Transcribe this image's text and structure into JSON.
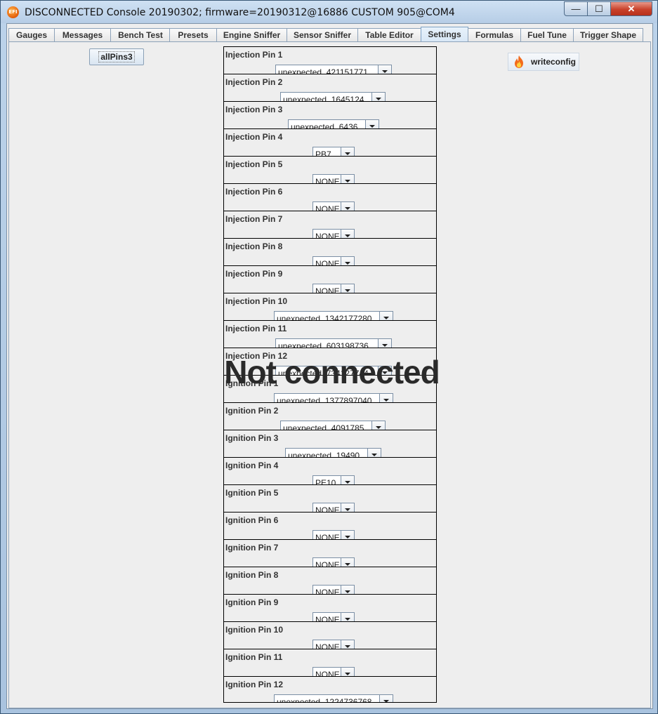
{
  "window": {
    "title": "DISCONNECTED Console 20190302; firmware=20190312@16886 CUSTOM 905@COM4",
    "icon_label": "EFI",
    "minimize_glyph": "—",
    "maximize_glyph": "☐",
    "close_glyph": "✕"
  },
  "tabs": [
    {
      "label": "Gauges"
    },
    {
      "label": "Messages"
    },
    {
      "label": "Bench Test"
    },
    {
      "label": "Presets"
    },
    {
      "label": "Engine Sniffer"
    },
    {
      "label": "Sensor Sniffer"
    },
    {
      "label": "Table Editor"
    },
    {
      "label": "Settings",
      "active": true
    },
    {
      "label": "Formulas"
    },
    {
      "label": "Fuel Tune"
    },
    {
      "label": "Trigger Shape"
    }
  ],
  "toolbar": {
    "all_pins_label": "allPins3",
    "write_config_label": "writeconfig",
    "write_config_icon": "flame-icon"
  },
  "overlay_text": "Not connected",
  "pins": [
    {
      "label": "Injection Pin 1",
      "value": "unexpected_421151771"
    },
    {
      "label": "Injection Pin 2",
      "value": "unexpected_1645124"
    },
    {
      "label": "Injection Pin 3",
      "value": "unexpected_6436"
    },
    {
      "label": "Injection Pin 4",
      "value": "PB7"
    },
    {
      "label": "Injection Pin 5",
      "value": "NONE"
    },
    {
      "label": "Injection Pin 6",
      "value": "NONE"
    },
    {
      "label": "Injection Pin 7",
      "value": "NONE"
    },
    {
      "label": "Injection Pin 8",
      "value": "NONE"
    },
    {
      "label": "Injection Pin 9",
      "value": "NONE"
    },
    {
      "label": "Injection Pin 10",
      "value": "unexpected_1342177280"
    },
    {
      "label": "Injection Pin 11",
      "value": "unexpected_603198736"
    },
    {
      "label": "Injection Pin 12",
      "value": "unexpected_734127744"
    },
    {
      "label": "Ignition Pin 1",
      "value": "unexpected_1377897040"
    },
    {
      "label": "Ignition Pin 2",
      "value": "unexpected_4091785"
    },
    {
      "label": "Ignition Pin 3",
      "value": "unexpected_19490"
    },
    {
      "label": "Ignition Pin 4",
      "value": "PE10"
    },
    {
      "label": "Ignition Pin 5",
      "value": "NONE"
    },
    {
      "label": "Ignition Pin 6",
      "value": "NONE"
    },
    {
      "label": "Ignition Pin 7",
      "value": "NONE"
    },
    {
      "label": "Ignition Pin 8",
      "value": "NONE"
    },
    {
      "label": "Ignition Pin 9",
      "value": "NONE"
    },
    {
      "label": "Ignition Pin 10",
      "value": "NONE"
    },
    {
      "label": "Ignition Pin 11",
      "value": "NONE"
    },
    {
      "label": "Ignition Pin 12",
      "value": "unexpected_1224736768"
    }
  ]
}
